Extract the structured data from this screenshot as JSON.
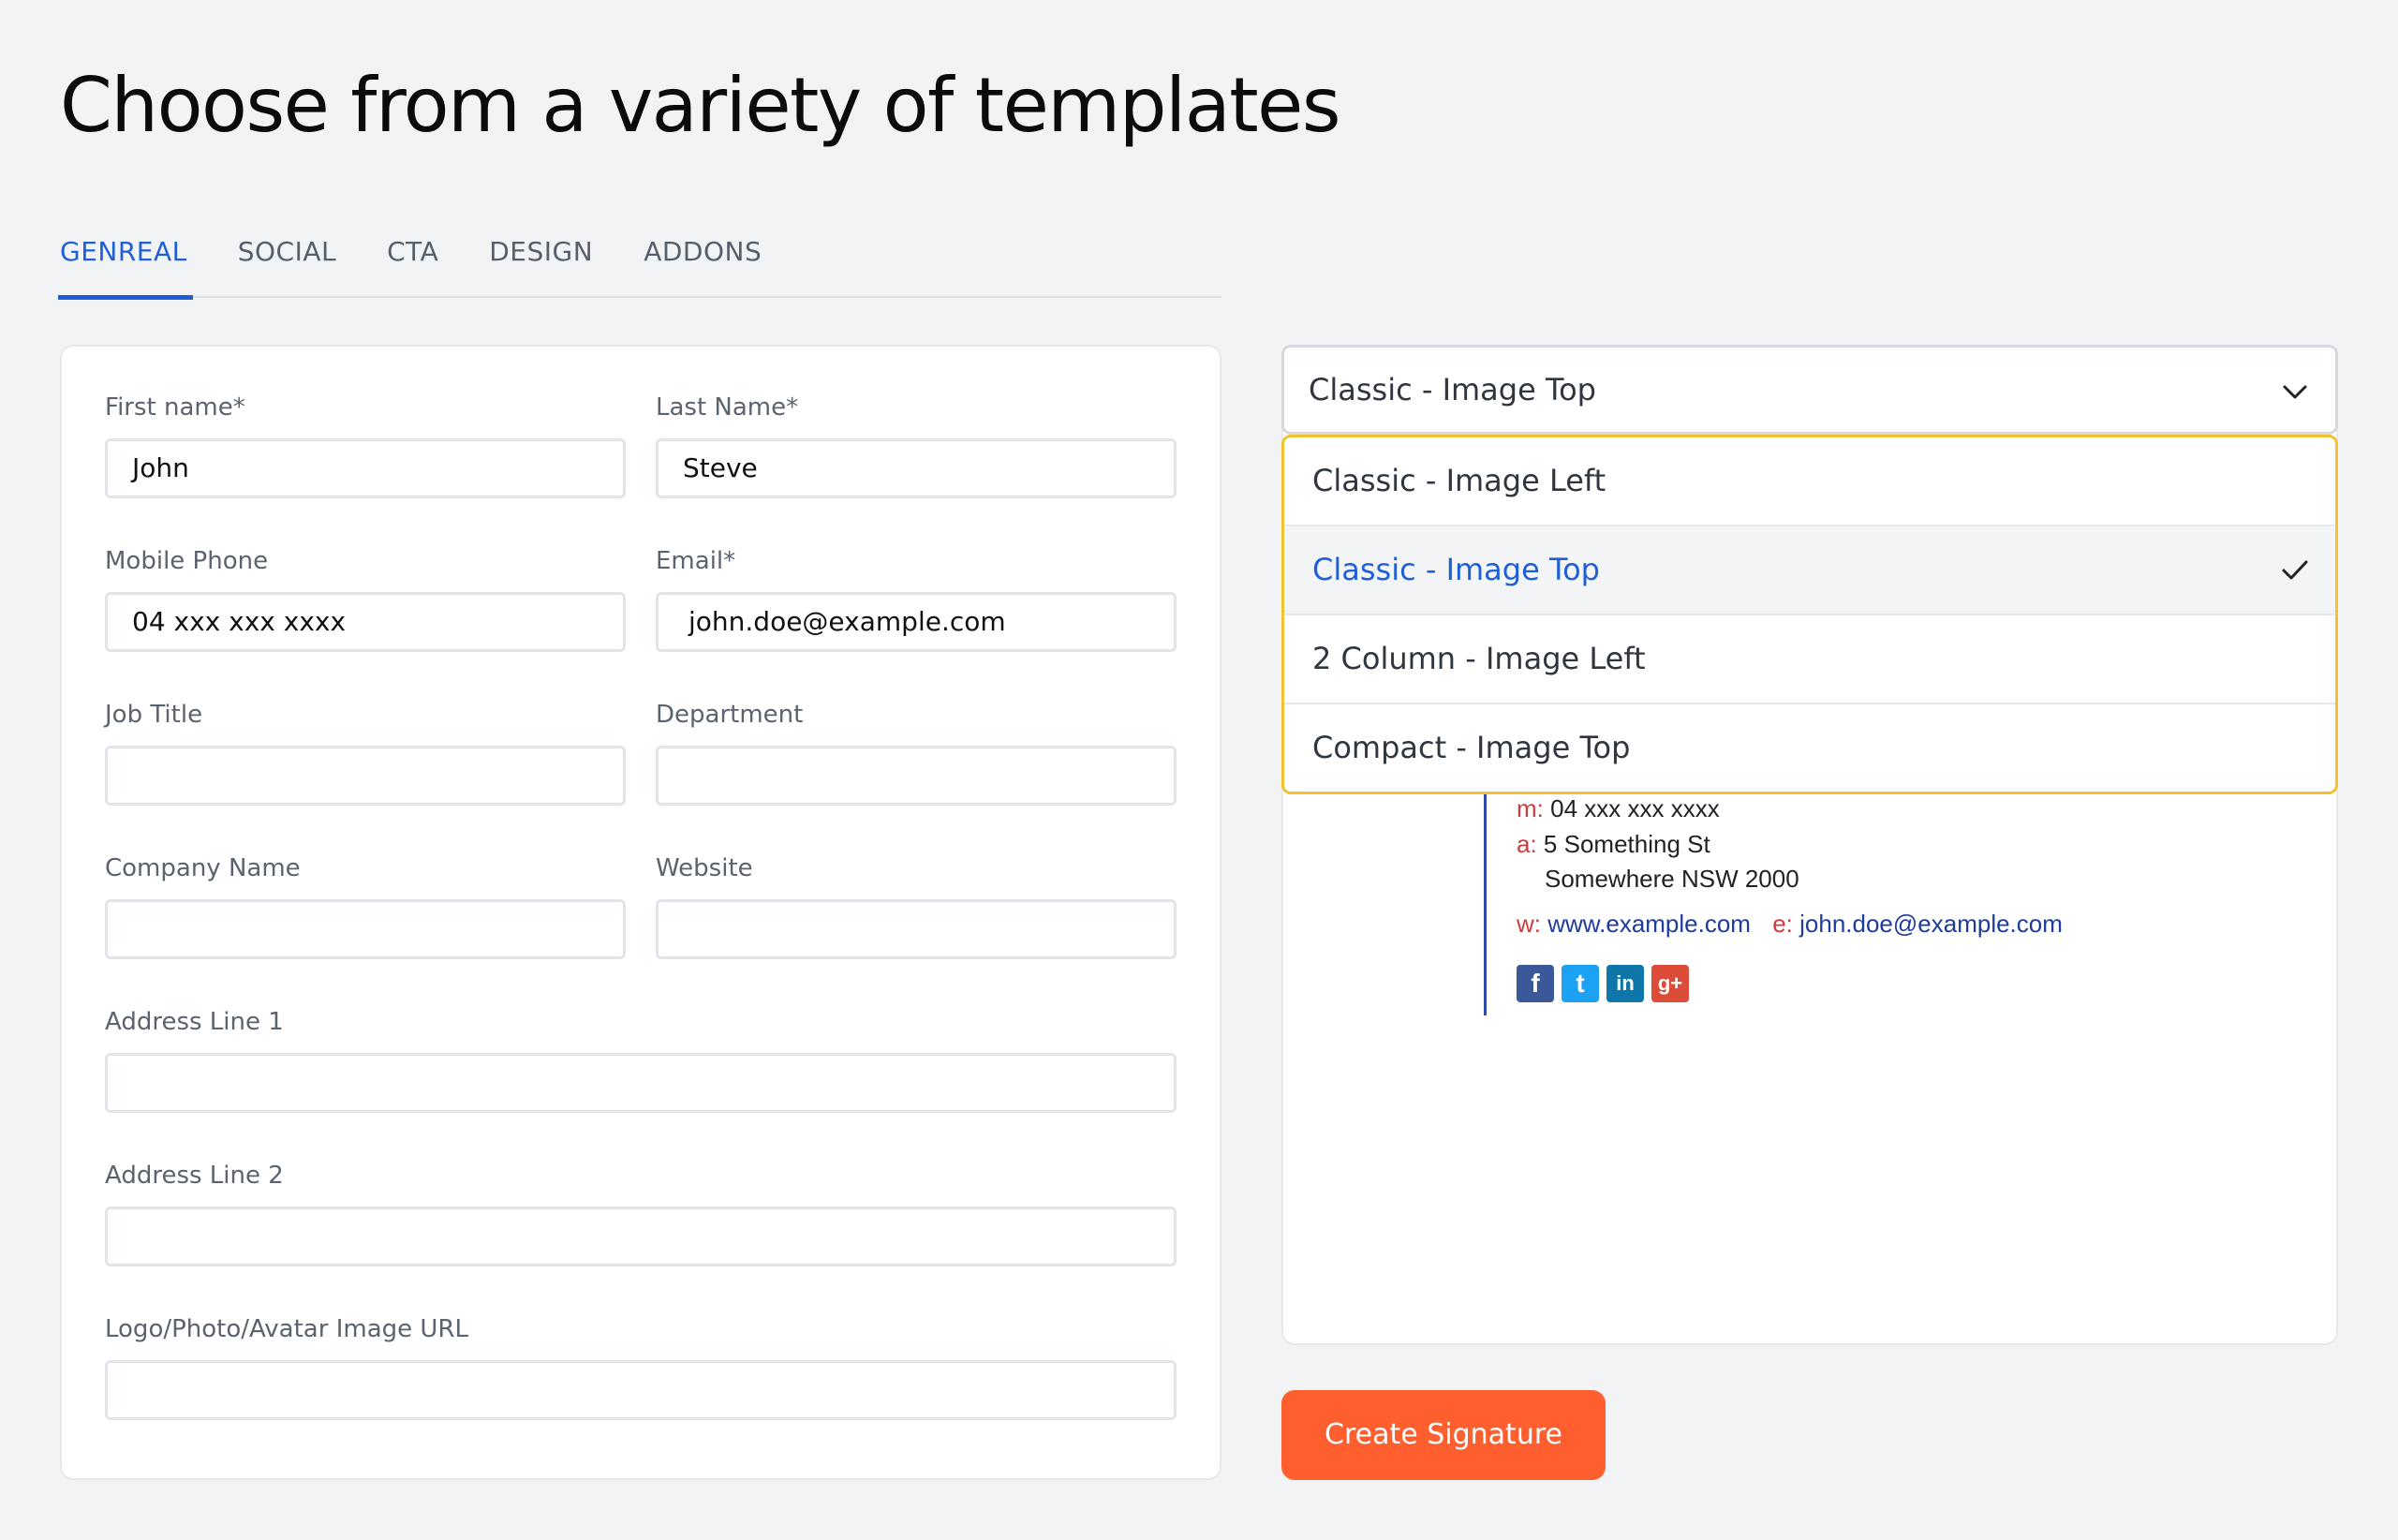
{
  "page": {
    "title": "Choose from a variety of templates"
  },
  "tabs": [
    {
      "label": "GENREAL",
      "active": true
    },
    {
      "label": "SOCIAL"
    },
    {
      "label": "CTA"
    },
    {
      "label": "DESIGN"
    },
    {
      "label": "ADDONS"
    }
  ],
  "form": {
    "first_name": {
      "label": "First name*",
      "value": "John"
    },
    "last_name": {
      "label": "Last Name*",
      "value": "Steve"
    },
    "mobile_phone": {
      "label": "Mobile Phone",
      "value": "04 xxx xxx xxxx"
    },
    "email": {
      "label": "Email*",
      "value": "john.doe@example.com"
    },
    "job_title": {
      "label": "Job Title",
      "value": ""
    },
    "department": {
      "label": "Department",
      "value": ""
    },
    "company_name": {
      "label": "Company Name",
      "value": ""
    },
    "website": {
      "label": "Website",
      "value": ""
    },
    "address_line_1": {
      "label": "Address Line 1",
      "value": ""
    },
    "address_line_2": {
      "label": "Address Line 2",
      "value": ""
    },
    "logo_url": {
      "label": "Logo/Photo/Avatar Image URL",
      "value": ""
    }
  },
  "template_select": {
    "selected": "Classic - Image Top",
    "options": [
      "Classic - Image Left",
      "Classic - Image Top",
      "2 Column - Image Left",
      "Compact - Image Top"
    ]
  },
  "signature": {
    "mobile_key": "m:",
    "mobile": "04 xxx xxx xxxx",
    "address_key": "a:",
    "address_line_1": "5 Something St",
    "address_line_2": "Somewhere NSW 2000",
    "website_key": "w:",
    "website": "www.example.com",
    "email_key": "e:",
    "email": "john.doe@example.com",
    "social_icons": [
      {
        "name": "facebook-icon",
        "glyph": "f",
        "color": "#3b5998"
      },
      {
        "name": "twitter-icon",
        "glyph": "t",
        "color": "#1da1f2"
      },
      {
        "name": "linkedin-icon",
        "glyph": "in",
        "color": "#0e76a8"
      },
      {
        "name": "google-plus-icon",
        "glyph": "g+",
        "color": "#dd4b39"
      }
    ]
  },
  "actions": {
    "create_label": "Create Signature"
  },
  "colors": {
    "accent": "#1f5fd6",
    "cta": "#ff5f2e",
    "dropdown_border": "#f2c230"
  }
}
